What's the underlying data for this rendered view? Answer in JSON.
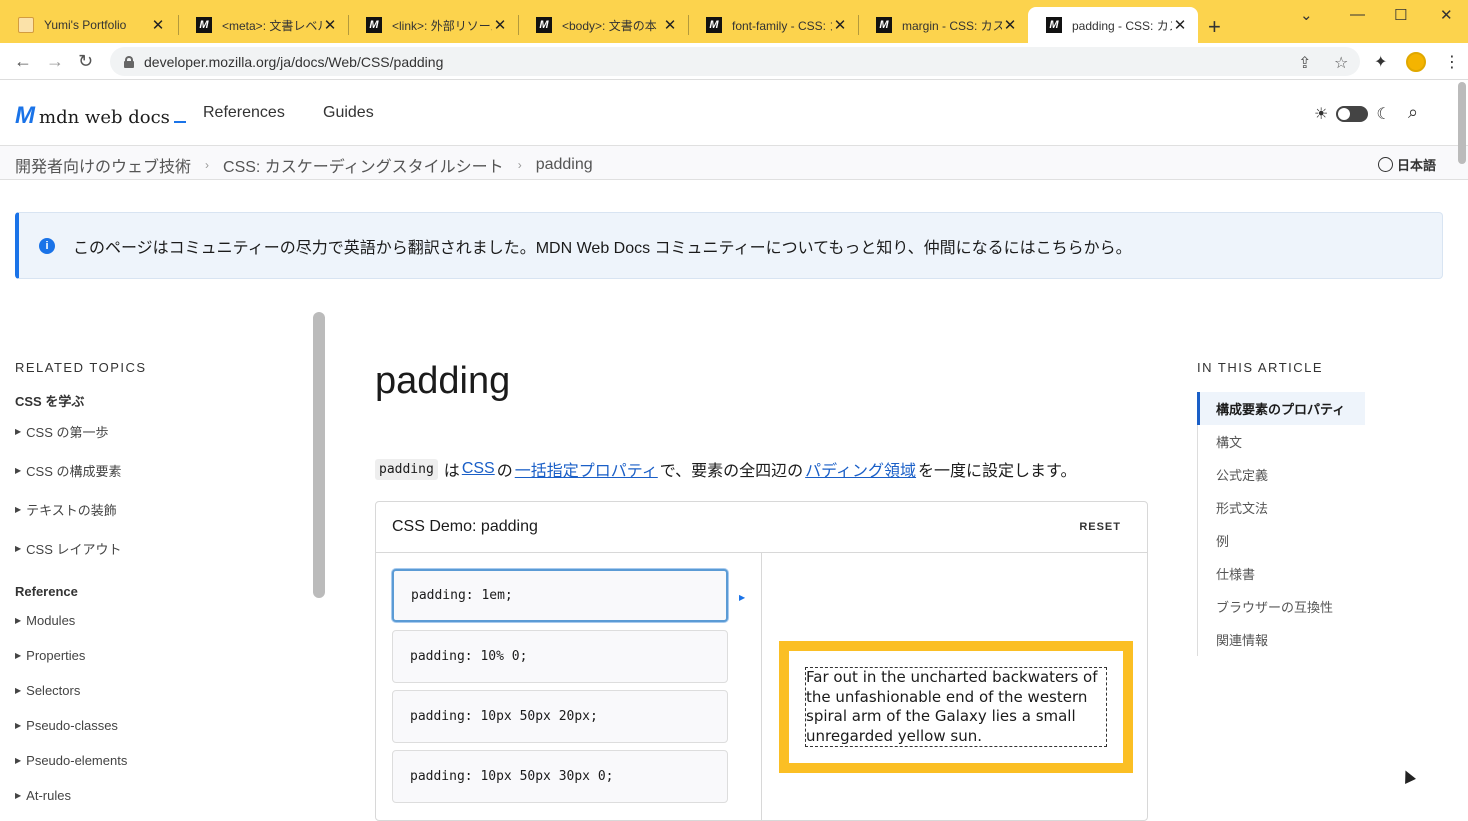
{
  "browser": {
    "tabs": [
      {
        "title": "Yumi's Portfolio",
        "icon": "portfolio-icon"
      },
      {
        "title": "<meta>: 文書レベル",
        "icon": "mdn-icon"
      },
      {
        "title": "<link>: 外部リソース",
        "icon": "mdn-icon"
      },
      {
        "title": "<body>: 文書の本",
        "icon": "mdn-icon"
      },
      {
        "title": "font-family - CSS: カ",
        "icon": "mdn-icon"
      },
      {
        "title": "margin - CSS: カスケ",
        "icon": "mdn-icon"
      },
      {
        "title": "padding - CSS: カス",
        "icon": "mdn-icon",
        "active": true
      }
    ],
    "url": "developer.mozilla.org/ja/docs/Web/CSS/padding",
    "tab_close_glyph": "✕",
    "new_tab_glyph": "+"
  },
  "header": {
    "logo_text": "mdn web docs",
    "logo_mark": "M",
    "nav": [
      "References",
      "Guides"
    ]
  },
  "breadcrumb": {
    "items": [
      "開発者向けのウェブ技術",
      "CSS: カスケーディングスタイルシート",
      "padding"
    ],
    "language": "日本語"
  },
  "notice": {
    "text": "このページはコミュニティーの尽力で英語から翻訳されました。MDN Web Docs コミュニティーについてもっと知り、仲間になるにはこちらから。"
  },
  "sidebar": {
    "heading": "RELATED TOPICS",
    "group1": "CSS を学ぶ",
    "group1_items": [
      "CSS の第一歩",
      "CSS の構成要素",
      "テキストの装飾",
      "CSS レイアウト"
    ],
    "group2": "Reference",
    "group2_items": [
      "Modules",
      "Properties",
      "Selectors",
      "Pseudo-classes",
      "Pseudo-elements",
      "At-rules"
    ]
  },
  "article": {
    "title": "padding",
    "intro": {
      "code": "padding",
      "t1": "は",
      "link1": "CSS",
      "t2": "の",
      "link2": "一括指定プロパティ",
      "t3": "で、要素の全四辺の",
      "link3": "パディング領域",
      "t4": "を一度に設定します。"
    },
    "demo": {
      "title": "CSS Demo: padding",
      "reset": "RESET",
      "choices": [
        "padding: 1em;",
        "padding: 10% 0;",
        "padding: 10px 50px 20px;",
        "padding: 10px 50px 30px 0;"
      ],
      "selected_index": 0,
      "sample_text": "Far out in the uncharted backwaters of the unfashionable end of the western spiral arm of the Galaxy lies a small unregarded yellow sun."
    }
  },
  "toc": {
    "heading": "IN THIS ARTICLE",
    "items": [
      "構成要素のプロパティ",
      "構文",
      "公式定義",
      "形式文法",
      "例",
      "仕様書",
      "ブラウザーの互換性",
      "関連情報"
    ]
  },
  "colors": {
    "tabbar": "#fcd34d",
    "accent": "#1a73e8",
    "demo_border": "#fbbf24"
  }
}
